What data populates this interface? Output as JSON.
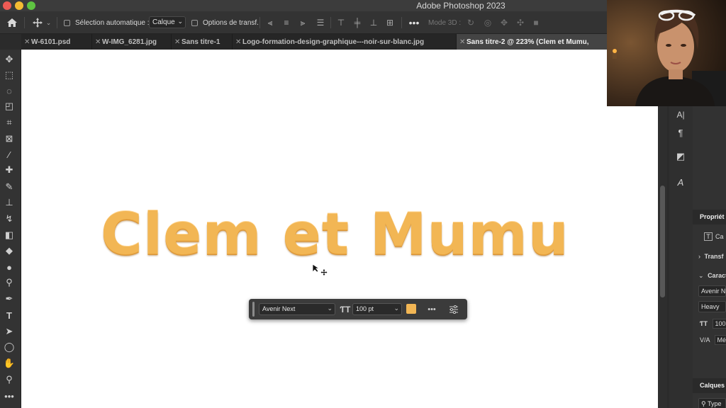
{
  "window": {
    "title": "Adobe Photoshop 2023"
  },
  "options_bar": {
    "auto_select_label": "Sélection automatique :",
    "auto_select_value": "Calque",
    "transform_label": "Options de transf.",
    "mode3d_label": "Mode 3D :"
  },
  "tabs": [
    {
      "label": "W-6101.psd",
      "active": false
    },
    {
      "label": "W-IMG_6281.jpg",
      "active": false
    },
    {
      "label": "Sans titre-1",
      "active": false
    },
    {
      "label": "Logo-formation-design-graphique---noir-sur-blanc.jpg",
      "active": false
    },
    {
      "label": "Sans titre-2 @ 223% (Clem et Mumu,",
      "active": true
    }
  ],
  "canvas": {
    "text": "Clem et Mumu",
    "text_color": "#f2b654"
  },
  "context_bar": {
    "font_family": "Avenir Next",
    "font_size": "100 pt",
    "color": "#f2b654"
  },
  "properties_panel": {
    "title": "Propriét",
    "layer_type": "Ca",
    "transform": "Transf",
    "character": "Caract",
    "font_family": "Avenir N",
    "font_style": "Heavy",
    "font_size": "100",
    "tracking_label": "V/A",
    "tracking_value": "Mé"
  },
  "layers_panel": {
    "title": "Calques",
    "filter": "Type"
  },
  "icons": {
    "home": "home-icon",
    "move": "move-icon",
    "more": "more-icon",
    "close": "close-icon"
  }
}
